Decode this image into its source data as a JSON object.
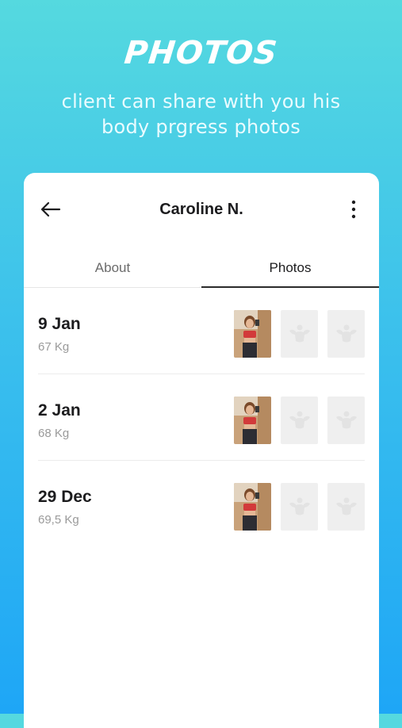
{
  "promo": {
    "title": "PHOTOS",
    "subtitle": "client can share with you his body prgress photos"
  },
  "header": {
    "title": "Caroline N.",
    "back_icon": "arrow-left-icon",
    "more_icon": "more-vertical-icon"
  },
  "tabs": [
    {
      "label": "About",
      "active": false
    },
    {
      "label": "Photos",
      "active": true
    }
  ],
  "entries": [
    {
      "date": "9 Jan",
      "weight": "67 Kg"
    },
    {
      "date": "2 Jan",
      "weight": "68 Kg"
    },
    {
      "date": "29 Dec",
      "weight": "69,5 Kg"
    }
  ],
  "colors": {
    "gradient_top": "#55d9df",
    "gradient_bottom": "#1ea6f6",
    "tab_indicator": "#2b2b2b",
    "placeholder_bg": "#efefef"
  }
}
